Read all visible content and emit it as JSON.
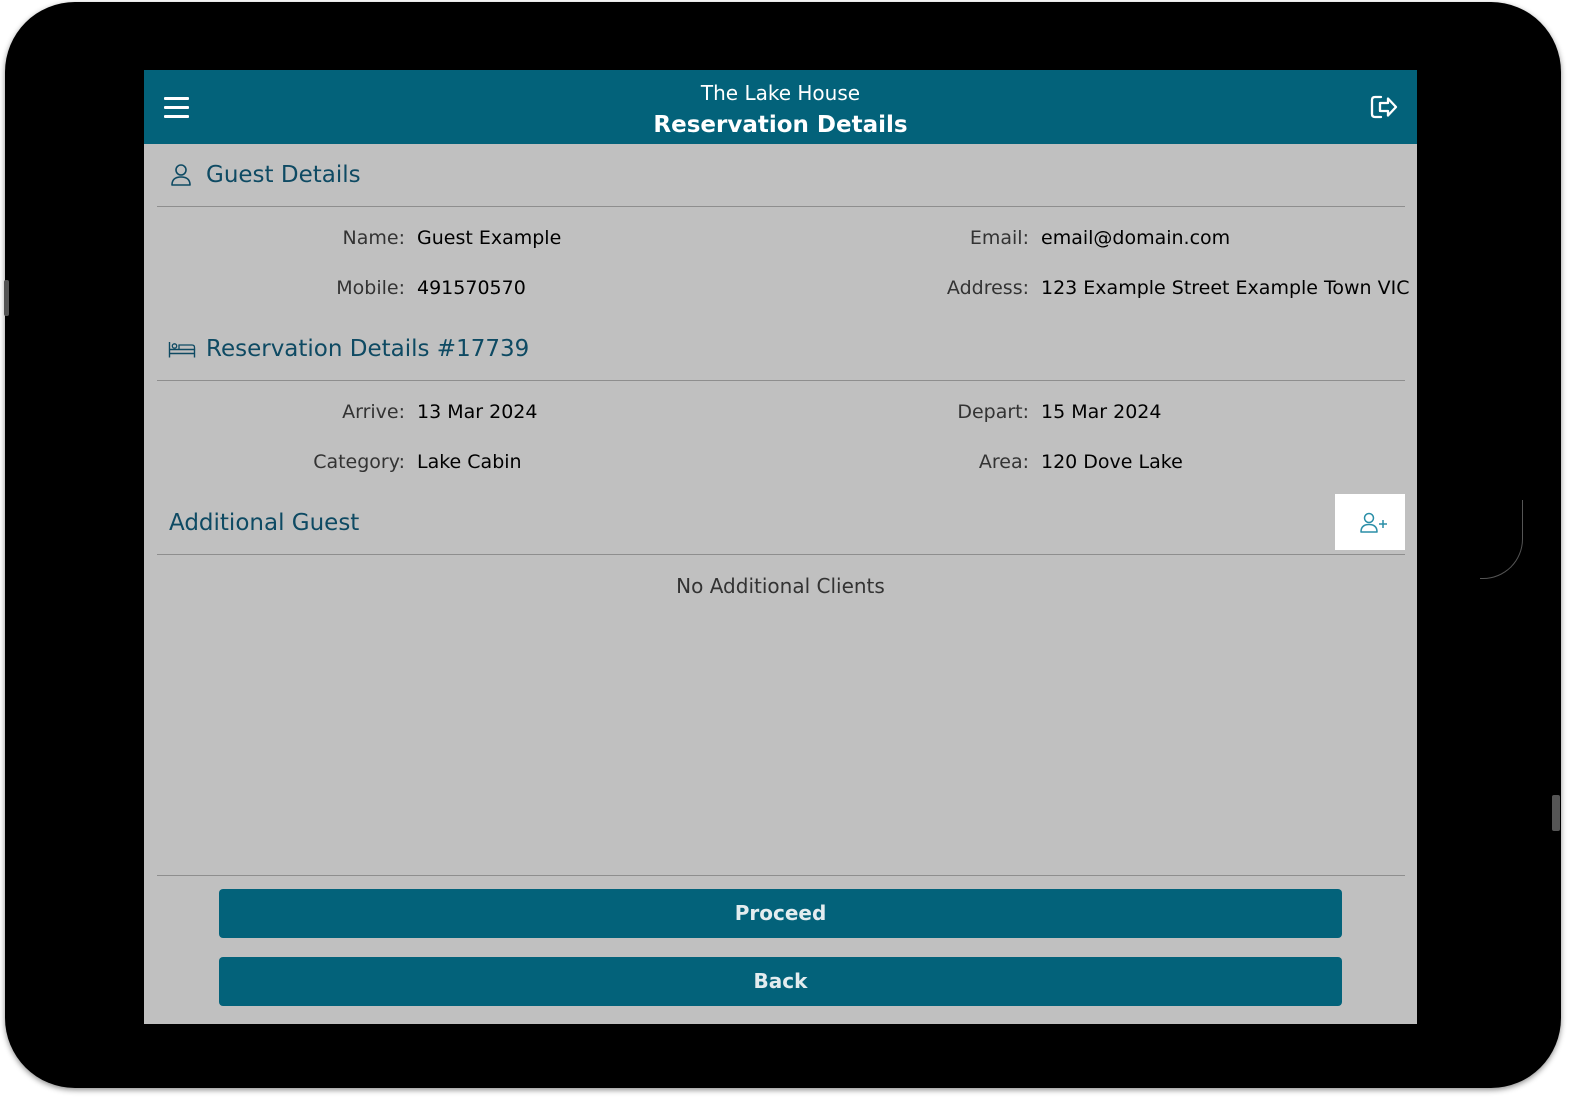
{
  "header": {
    "app_name": "The Lake House",
    "page_title": "Reservation Details"
  },
  "guest_details": {
    "title": "Guest Details",
    "fields": {
      "name_label": "Name:",
      "name_value": "Guest Example",
      "email_label": "Email:",
      "email_value": "email@domain.com",
      "mobile_label": "Mobile:",
      "mobile_value": "491570570",
      "address_label": "Address:",
      "address_value": "123 Example Street Example Town VIC"
    }
  },
  "reservation": {
    "title": "Reservation Details #17739",
    "fields": {
      "arrive_label": "Arrive:",
      "arrive_value": "13 Mar 2024",
      "depart_label": "Depart:",
      "depart_value": "15 Mar 2024",
      "category_label": "Category:",
      "category_value": "Lake Cabin",
      "area_label": "Area:",
      "area_value": "120 Dove Lake"
    }
  },
  "additional_guest": {
    "title": "Additional Guest",
    "empty_message": "No Additional Clients"
  },
  "actions": {
    "proceed_label": "Proceed",
    "back_label": "Back"
  },
  "icons": {
    "menu": "menu-icon",
    "logout": "logout-icon",
    "guest": "person-icon",
    "reservation": "bed-icon",
    "add_guest": "add-person-icon"
  },
  "colors": {
    "primary": "#03627a",
    "heading": "#0e4a63",
    "background": "#c0c0c0"
  }
}
